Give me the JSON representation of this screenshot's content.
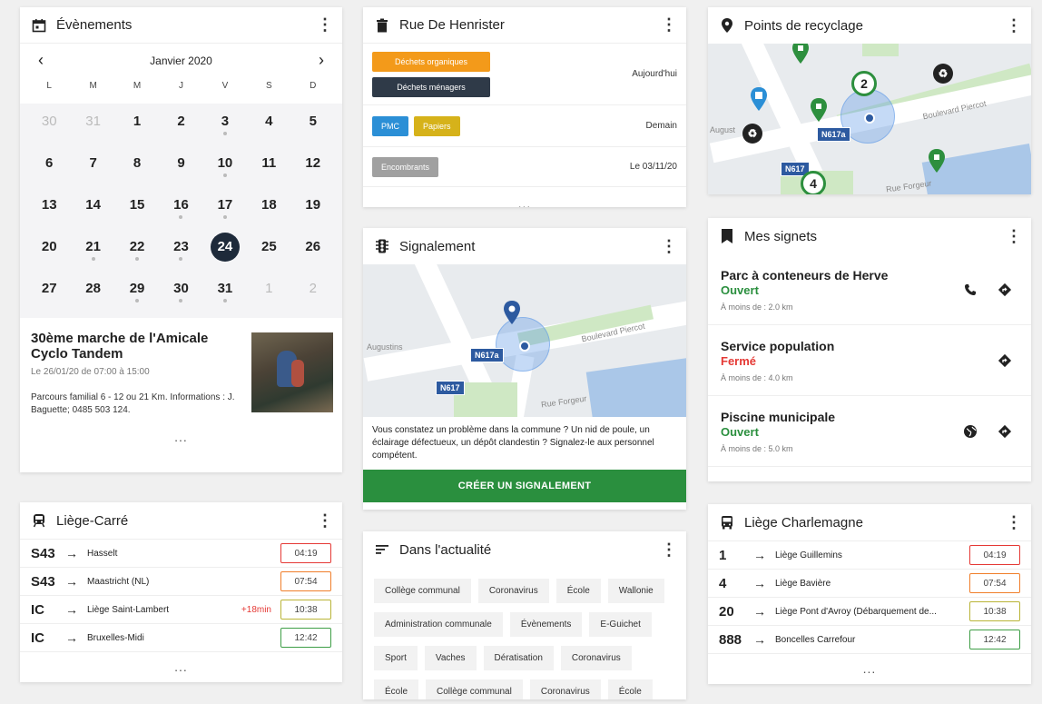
{
  "events": {
    "title": "Évènements",
    "month": "Janvier 2020",
    "dows": [
      "L",
      "M",
      "M",
      "J",
      "V",
      "S",
      "D"
    ],
    "weeks": [
      [
        {
          "d": "30",
          "m": true
        },
        {
          "d": "31",
          "m": true
        },
        {
          "d": "1"
        },
        {
          "d": "2"
        },
        {
          "d": "3",
          "dot": true
        },
        {
          "d": "4"
        },
        {
          "d": "5"
        }
      ],
      [
        {
          "d": "6"
        },
        {
          "d": "7"
        },
        {
          "d": "8"
        },
        {
          "d": "9"
        },
        {
          "d": "10",
          "dot": true
        },
        {
          "d": "11"
        },
        {
          "d": "12"
        }
      ],
      [
        {
          "d": "13"
        },
        {
          "d": "14"
        },
        {
          "d": "15"
        },
        {
          "d": "16",
          "dot": true
        },
        {
          "d": "17",
          "dot": true
        },
        {
          "d": "18"
        },
        {
          "d": "19"
        }
      ],
      [
        {
          "d": "20"
        },
        {
          "d": "21",
          "dot": true
        },
        {
          "d": "22",
          "dot": true
        },
        {
          "d": "23",
          "dot": true
        },
        {
          "d": "24",
          "sel": true
        },
        {
          "d": "25"
        },
        {
          "d": "26"
        }
      ],
      [
        {
          "d": "27"
        },
        {
          "d": "28"
        },
        {
          "d": "29",
          "dot": true
        },
        {
          "d": "30",
          "dot": true
        },
        {
          "d": "31",
          "dot": true
        },
        {
          "d": "1",
          "m": true
        },
        {
          "d": "2",
          "m": true
        }
      ]
    ],
    "event_title": "30ème marche de l'Amicale Cyclo Tandem",
    "event_date": "Le 26/01/20 de 07:00 à 15:00",
    "event_desc": "Parcours familial 6 - 12 ou 21 Km. Informations : J. Baguette; 0485 503 124.",
    "more": "..."
  },
  "liege_carre": {
    "title": "Liège-Carré",
    "rows": [
      {
        "line": "S43",
        "dest": "Hasselt",
        "delay": "",
        "time": "04:19",
        "color": "red"
      },
      {
        "line": "S43",
        "dest": "Maastricht (NL)",
        "delay": "",
        "time": "07:54",
        "color": "orange"
      },
      {
        "line": "IC",
        "dest": "Liège Saint-Lambert",
        "delay": "+18min",
        "time": "10:38",
        "color": "olive"
      },
      {
        "line": "IC",
        "dest": "Bruxelles-Midi",
        "delay": "",
        "time": "12:42",
        "color": "green"
      }
    ],
    "more": "..."
  },
  "waste": {
    "title": "Rue De Henrister",
    "rows": [
      {
        "tags": [
          {
            "label": "Déchets organiques",
            "color": "#f39a1a"
          },
          {
            "label": "Déchets ménagers",
            "color": "#2f3a48"
          }
        ],
        "when": "Aujourd'hui"
      },
      {
        "tags": [
          {
            "label": "PMC",
            "color": "#2b8fd6"
          },
          {
            "label": "Papiers",
            "color": "#d6b21a"
          }
        ],
        "when": "Demain"
      },
      {
        "tags": [
          {
            "label": "Encombrants",
            "color": "#a0a0a0"
          }
        ],
        "when": "Le 03/11/20"
      }
    ],
    "more": "..."
  },
  "signal": {
    "title": "Signalement",
    "map": {
      "boulevard": "Boulevard Piercot",
      "augustins": "Augustins",
      "n617a": "N617a",
      "n617": "N617",
      "forgeur": "Rue Forgeur"
    },
    "text": "Vous constatez un problème dans la commune ? Un nid de poule, un éclairage défectueux, un dépôt clandestin ? Signalez-le aux personnel compétent.",
    "cta": "CRÉER UN SIGNALEMENT"
  },
  "news": {
    "title": "Dans l'actualité",
    "tags": [
      "Collège communal",
      "Coronavirus",
      "École",
      "Wallonie",
      "Administration communale",
      "Évènements",
      "E-Guichet",
      "Sport",
      "Vaches",
      "Dératisation",
      "Coronavirus",
      "École",
      "Collège communal",
      "Coronavirus",
      "École"
    ]
  },
  "recycle": {
    "title": "Points de recyclage",
    "map": {
      "boulevard": "Boulevard Piercot",
      "august": "August",
      "n617a": "N617a",
      "n617": "N617",
      "forgeur": "Rue Forgeur",
      "c2": "2",
      "c4": "4"
    }
  },
  "bookmarks": {
    "title": "Mes signets",
    "items": [
      {
        "name": "Parc à conteneurs de Herve",
        "status": "Ouvert",
        "open": true,
        "dist": "À moins de : 2.0 km",
        "actions": [
          "phone",
          "directions"
        ]
      },
      {
        "name": "Service population",
        "status": "Fermé",
        "open": false,
        "dist": "À moins de : 4.0 km",
        "actions": [
          "directions"
        ]
      },
      {
        "name": "Piscine municipale",
        "status": "Ouvert",
        "open": true,
        "dist": "À moins de : 5.0 km",
        "actions": [
          "globe",
          "directions"
        ]
      }
    ],
    "more": "..."
  },
  "charlemagne": {
    "title": "Liège Charlemagne",
    "rows": [
      {
        "line": "1",
        "dest": "Liège Guillemins",
        "time": "04:19",
        "color": "red"
      },
      {
        "line": "4",
        "dest": "Liège Bavière",
        "time": "07:54",
        "color": "orange"
      },
      {
        "line": "20",
        "dest": "Liège Pont d'Avroy (Débarquement de...",
        "time": "10:38",
        "color": "olive"
      },
      {
        "line": "888",
        "dest": "Boncelles Carrefour",
        "time": "12:42",
        "color": "green"
      }
    ],
    "more": "..."
  },
  "colors": {
    "accent": "#2a8f3e",
    "selected_day": "#1e2a3a",
    "open": "#2a8f3e",
    "closed": "#e53935",
    "pin": "#2d8f3e",
    "pin_blue": "#2d5aa0"
  }
}
